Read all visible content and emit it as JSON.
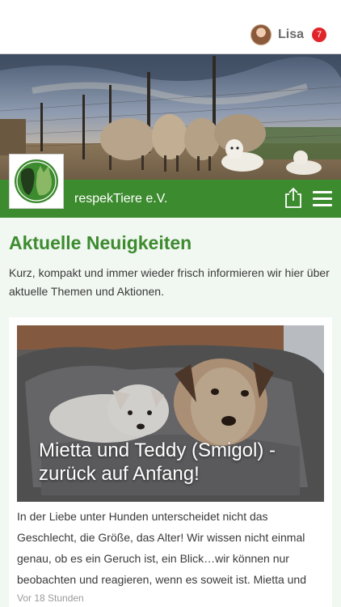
{
  "header": {
    "user_name": "Lisa",
    "notification_count": "7"
  },
  "org": {
    "name": "respekTiere e.V."
  },
  "news": {
    "title": "Aktuelle Neuigkeiten",
    "description": "Kurz, kompakt und immer wieder frisch informieren wir hier über aktuelle Themen und Aktionen."
  },
  "article": {
    "title": "Mietta und Teddy (Smigol) - zurück auf Anfang!",
    "excerpt": "In der Liebe unter Hunden unterscheidet nicht das Geschlecht, die Größe, das Alter! Wir wissen nicht einmal genau, ob es ein Geruch ist, ein Blick…wir können nur beobachten und reagieren, wenn es soweit ist. Mietta und",
    "time": "Vor 18 Stunden"
  },
  "colors": {
    "brand_green": "#3d8b2f",
    "badge_red": "#e1242a",
    "content_bg": "#f1f7f1"
  },
  "icons": {
    "share": "share-icon",
    "menu": "hamburger-menu-icon"
  }
}
